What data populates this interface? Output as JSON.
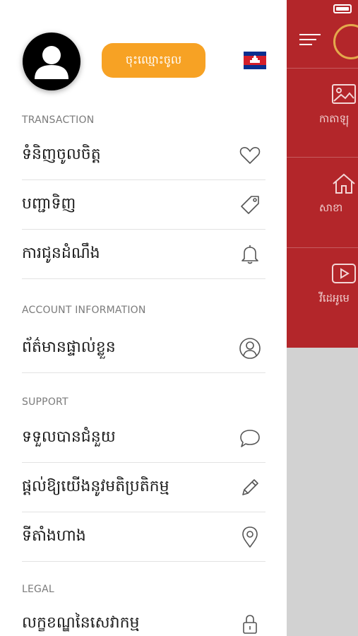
{
  "drawer": {
    "login_label": "ចុះឈ្មោះចូល",
    "sections": {
      "transaction": "TRANSACTION",
      "account": "ACCOUNT INFORMATION",
      "support": "SUPPORT",
      "legal": "LEGAL"
    },
    "items": {
      "favorites": "ទំនិញចូលចិត្ត",
      "orders": "បញ្ជាទិញ",
      "notifications": "ការជូនដំណឹង",
      "profile": "ព័ត៌មានផ្ទាល់ខ្លួន",
      "help": "ទទួលបានជំនួយ",
      "feedback": "ផ្តល់ឱ្យយើងនូវមតិប្រតិកម្ម",
      "locations": "ទីតាំងហាង",
      "terms": "លក្ខខណ្ឌនៃសេវាកម្ម"
    }
  },
  "background_app": {
    "tiles": [
      "កាតាឡុ",
      "សាខា",
      "វីដេអូមេ"
    ]
  },
  "colors": {
    "accent_orange": "#f7a224",
    "brand_red": "#b3262a"
  },
  "icons": {
    "favorites": "heart-icon",
    "orders": "tag-icon",
    "notifications": "bell-icon",
    "profile": "user-circle-icon",
    "help": "chat-bubble-icon",
    "feedback": "pencil-icon",
    "locations": "map-pin-icon",
    "terms": "lock-icon"
  }
}
